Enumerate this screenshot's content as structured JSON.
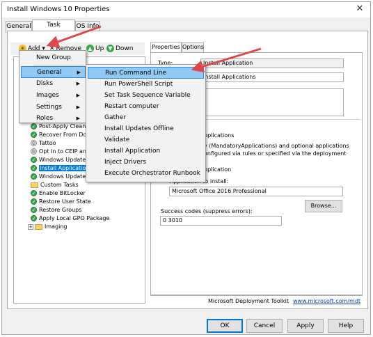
{
  "window": {
    "title": "Install Windows 10 Properties",
    "close_glyph": "✕"
  },
  "tabs": [
    {
      "label": "General"
    },
    {
      "label": "Task Sequence"
    },
    {
      "label": "OS Info"
    }
  ],
  "toolbar": {
    "add_label": "Add",
    "remove_label": "Remove",
    "up_label": "Up",
    "down_label": "Down"
  },
  "tree": {
    "items": [
      {
        "label": "Post-Apply Cleanup",
        "icon": "check-green"
      },
      {
        "label": "Recover From Domain",
        "icon": "check-green"
      },
      {
        "label": "Tattoo",
        "icon": "gear-grey"
      },
      {
        "label": "Opt In to CEIP and WER",
        "icon": "gear-grey"
      },
      {
        "label": "Windows Update (Pre-Application Installation)",
        "icon": "check-green"
      },
      {
        "label": "Install Applications",
        "icon": "check-green",
        "selected": true
      },
      {
        "label": "Windows Update (Post-Application Installation)",
        "icon": "check-green"
      },
      {
        "label": "Custom Tasks",
        "icon": "folder"
      },
      {
        "label": "Enable BitLocker",
        "icon": "check-green"
      },
      {
        "label": "Restore User State",
        "icon": "check-green"
      },
      {
        "label": "Restore Groups",
        "icon": "check-green"
      },
      {
        "label": "Apply Local GPO Package",
        "icon": "check-green"
      },
      {
        "label": "Imaging",
        "icon": "folder",
        "expander": "+"
      }
    ]
  },
  "props_tabs": [
    {
      "label": "Properties"
    },
    {
      "label": "Options"
    }
  ],
  "properties": {
    "type_label": "Type:",
    "type_value": "Install Application",
    "name_value": "Install Applications",
    "radio_multi_text": "pplications",
    "desc_line1": "y (MandatoryApplications) and optional applications",
    "desc_line2": "onfigured via rules or specified via the deployment",
    "radio_single_text": "pplication",
    "app_label": "Application to install:",
    "app_value": "Microsoft Office 2016 Professional",
    "browse_label": "Browse...",
    "success_label": "Success codes (suppress errors):",
    "success_value": "0 3010",
    "footer_text": "Microsoft Deployment Toolkit",
    "footer_link": "www.microsoft.com/mdt"
  },
  "add_menu": {
    "items": [
      {
        "label": "New Group"
      },
      {
        "label": "General",
        "submenu": true,
        "highlighted": true
      },
      {
        "label": "Disks",
        "submenu": true
      },
      {
        "label": "Images",
        "submenu": true
      },
      {
        "label": "Settings",
        "submenu": true
      },
      {
        "label": "Roles",
        "submenu": true
      }
    ]
  },
  "general_submenu": {
    "items": [
      {
        "label": "Run Command Line",
        "highlighted": true
      },
      {
        "label": "Run PowerShell Script"
      },
      {
        "label": "Set Task Sequence Variable"
      },
      {
        "label": "Restart computer"
      },
      {
        "label": "Gather"
      },
      {
        "label": "Install Updates Offline"
      },
      {
        "label": "Validate"
      },
      {
        "label": "Install Application"
      },
      {
        "label": "Inject Drivers"
      },
      {
        "label": "Execute Orchestrator Runbook"
      }
    ]
  },
  "buttons": {
    "ok": "OK",
    "cancel": "Cancel",
    "apply": "Apply",
    "help": "Help"
  },
  "colors": {
    "accent": "#0078d7",
    "menu_highlight": "#91c9f7",
    "annotation_arrow": "#e0474c"
  }
}
